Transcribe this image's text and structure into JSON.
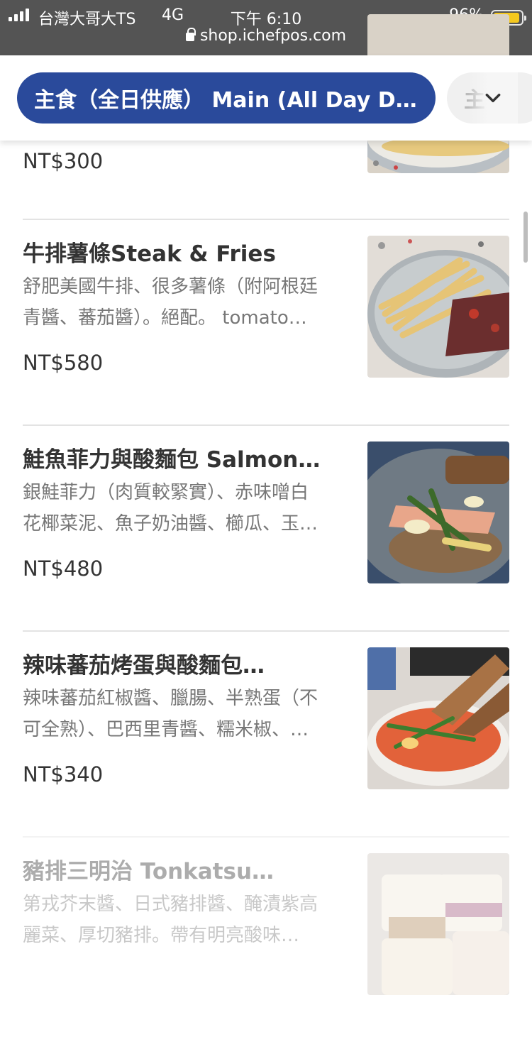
{
  "status_bar": {
    "carrier": "台灣大哥大TS",
    "network": "4G",
    "time": "下午 6:10",
    "battery_percent": "96%",
    "battery_level": 0.96,
    "url": "shop.ichefpos.com"
  },
  "category_bar": {
    "active_label": "主食（全日供應） Main (All Day D…",
    "next_label": "主",
    "expand_icon": "chevron-down-icon"
  },
  "items": [
    {
      "name": "",
      "desc": [
        "",
        ""
      ],
      "price": "NT$300"
    },
    {
      "name": "牛排薯條Steak & Fries",
      "desc": [
        "舒肥美國牛排、很多薯條（附阿根廷",
        "青醬、蕃茄醬）。絕配。 tomato…"
      ],
      "price": "NT$580"
    },
    {
      "name": "鮭魚菲力與酸麵包 Salmon…",
      "desc": [
        "銀鮭菲力（肉質較緊實）、赤味噌白",
        "花椰菜泥、魚子奶油醬、櫛瓜、玉…"
      ],
      "price": "NT$480"
    },
    {
      "name": "辣味蕃茄烤蛋與酸麵包…",
      "desc": [
        "辣味蕃茄紅椒醬、臘腸、半熟蛋（不",
        "可全熟）、巴西里青醬、糯米椒、…"
      ],
      "price": "NT$340"
    },
    {
      "name": "豬排三明治 Tonkatsu…",
      "desc": [
        "第戎芥末醬、日式豬排醬、醃漬紫高",
        "麗菜、厚切豬排。帶有明亮酸味…"
      ],
      "price": ""
    }
  ],
  "colors": {
    "status_bar_bg": "#545454",
    "category_active_bg": "#2a4a9b",
    "battery": "#f5c81f"
  }
}
